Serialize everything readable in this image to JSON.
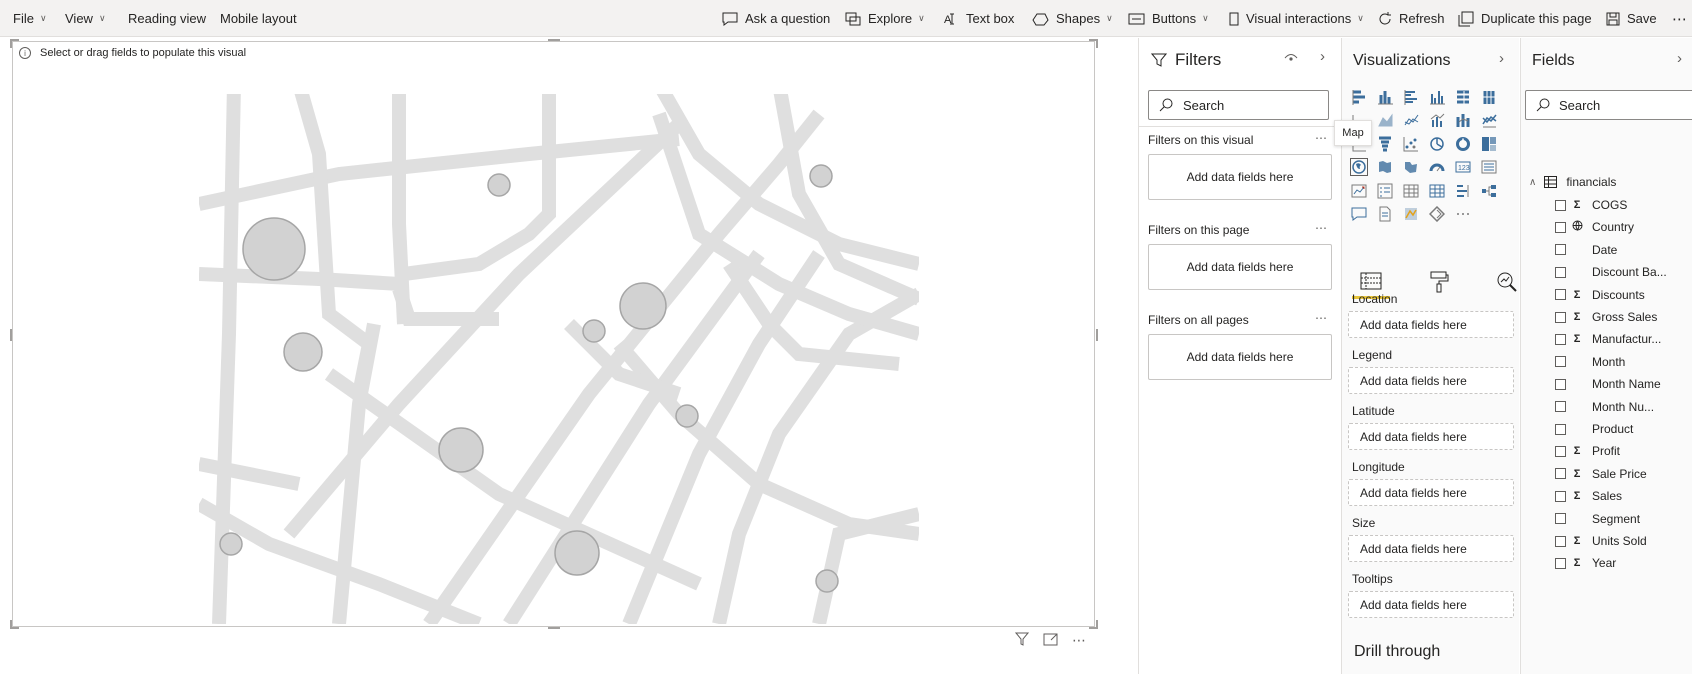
{
  "menu": {
    "file": "File",
    "view": "View",
    "reading_view": "Reading view",
    "mobile_layout": "Mobile layout",
    "ask_question": "Ask a question",
    "explore": "Explore",
    "text_box": "Text box",
    "shapes": "Shapes",
    "buttons": "Buttons",
    "visual_interactions": "Visual interactions",
    "refresh": "Refresh",
    "duplicate_page": "Duplicate this page",
    "save": "Save",
    "more": "⋯"
  },
  "visual": {
    "hint": "Select or drag fields to populate this visual",
    "map_color": "#d9d9d9",
    "bubble_color": "#d2d2d2"
  },
  "filters": {
    "title": "Filters",
    "search_placeholder": "Search",
    "sections": [
      {
        "label": "Filters on this visual",
        "well": "Add data fields here"
      },
      {
        "label": "Filters on this page",
        "well": "Add data fields here"
      },
      {
        "label": "Filters on all pages",
        "well": "Add data fields here"
      }
    ]
  },
  "visualizations": {
    "title": "Visualizations",
    "tooltip": "Map",
    "wells": [
      {
        "label": "Location",
        "placeholder": "Add data fields here"
      },
      {
        "label": "Legend",
        "placeholder": "Add data fields here"
      },
      {
        "label": "Latitude",
        "placeholder": "Add data fields here"
      },
      {
        "label": "Longitude",
        "placeholder": "Add data fields here"
      },
      {
        "label": "Size",
        "placeholder": "Add data fields here"
      },
      {
        "label": "Tooltips",
        "placeholder": "Add data fields here"
      }
    ],
    "drill_through": "Drill through",
    "accent_color": "#e8c53a"
  },
  "fields": {
    "title": "Fields",
    "search_placeholder": "Search",
    "table_name": "financials",
    "items": [
      {
        "name": "COGS",
        "sigma": true
      },
      {
        "name": "Country",
        "globe": true
      },
      {
        "name": "Date"
      },
      {
        "name": "Discount Ba..."
      },
      {
        "name": "Discounts",
        "sigma": true
      },
      {
        "name": "Gross Sales",
        "sigma": true
      },
      {
        "name": "Manufactur...",
        "sigma": true
      },
      {
        "name": "Month"
      },
      {
        "name": "Month Name"
      },
      {
        "name": "Month Nu..."
      },
      {
        "name": "Product"
      },
      {
        "name": "Profit",
        "sigma": true
      },
      {
        "name": "Sale Price",
        "sigma": true
      },
      {
        "name": "Sales",
        "sigma": true
      },
      {
        "name": "Segment"
      },
      {
        "name": "Units Sold",
        "sigma": true
      },
      {
        "name": "Year",
        "sigma": true
      }
    ]
  }
}
